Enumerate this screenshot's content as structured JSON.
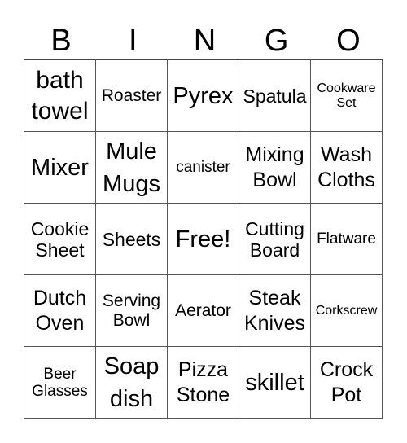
{
  "header": {
    "letters": [
      "B",
      "I",
      "N",
      "G",
      "O"
    ]
  },
  "grid": {
    "rows": [
      [
        "bath\ntowel",
        "Roaster",
        "Pyrex",
        "Spatula",
        "Cookware\nSet"
      ],
      [
        "Mixer",
        "Mule\nMugs",
        "canister",
        "Mixing\nBowl",
        "Wash\nCloths"
      ],
      [
        "Cookie\nSheet",
        "Sheets",
        "Free!",
        "Cutting\nBoard",
        "Flatware"
      ],
      [
        "Dutch\nOven",
        "Serving\nBowl",
        "Aerator",
        "Steak\nKnives",
        "Corkscrew"
      ],
      [
        "Beer\nGlasses",
        "Soap\ndish",
        "Pizza\nStone",
        "skillet",
        "Crock\nPot"
      ]
    ]
  },
  "colors": {
    "border": "#555555",
    "text": "#000000",
    "background": "#ffffff"
  }
}
